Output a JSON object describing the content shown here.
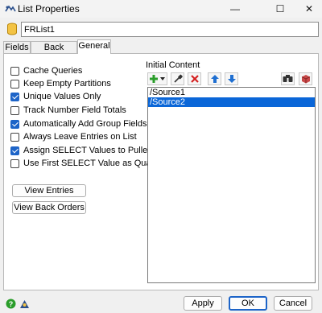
{
  "window": {
    "title": "List Properties",
    "min_glyph": "—",
    "max_glyph": "☐",
    "close_glyph": "✕"
  },
  "list_name": "FRList1",
  "tabs": [
    {
      "label": "Fields"
    },
    {
      "label": "Back Orders"
    },
    {
      "label": "General"
    }
  ],
  "options": [
    {
      "label": "Cache Queries",
      "checked": false
    },
    {
      "label": "Keep Empty Partitions",
      "checked": false
    },
    {
      "label": "Unique Values Only",
      "checked": true
    },
    {
      "label": "Track Number Field Totals",
      "checked": false
    },
    {
      "label": "Automatically Add Group Fields",
      "checked": true
    },
    {
      "label": "Always Leave Entries on List",
      "checked": false
    },
    {
      "label": "Assign SELECT Values to Puller Labels",
      "checked": true
    },
    {
      "label": "Use First SELECT Value as Quantifier",
      "checked": false
    }
  ],
  "buttons": {
    "view_entries": "View Entries",
    "view_back_orders": "View Back Orders"
  },
  "initial_content": {
    "label": "Initial Content",
    "items": [
      {
        "text": "/Source1",
        "selected": false
      },
      {
        "text": "/Source2",
        "selected": true
      }
    ],
    "toolbar_icons": [
      "add-icon",
      "dropdown-arrow-icon",
      "eyedropper-icon",
      "delete-icon",
      "move-up-icon",
      "move-down-icon",
      "find-icon",
      "cube-icon"
    ]
  },
  "footer": {
    "apply": "Apply",
    "ok": "OK",
    "cancel": "Cancel"
  },
  "colors": {
    "accent": "#1d64c8",
    "selection": "#0a66d8",
    "add_green": "#2a9d2a",
    "delete_red": "#d42020",
    "arrow_blue": "#1f6fd1"
  }
}
